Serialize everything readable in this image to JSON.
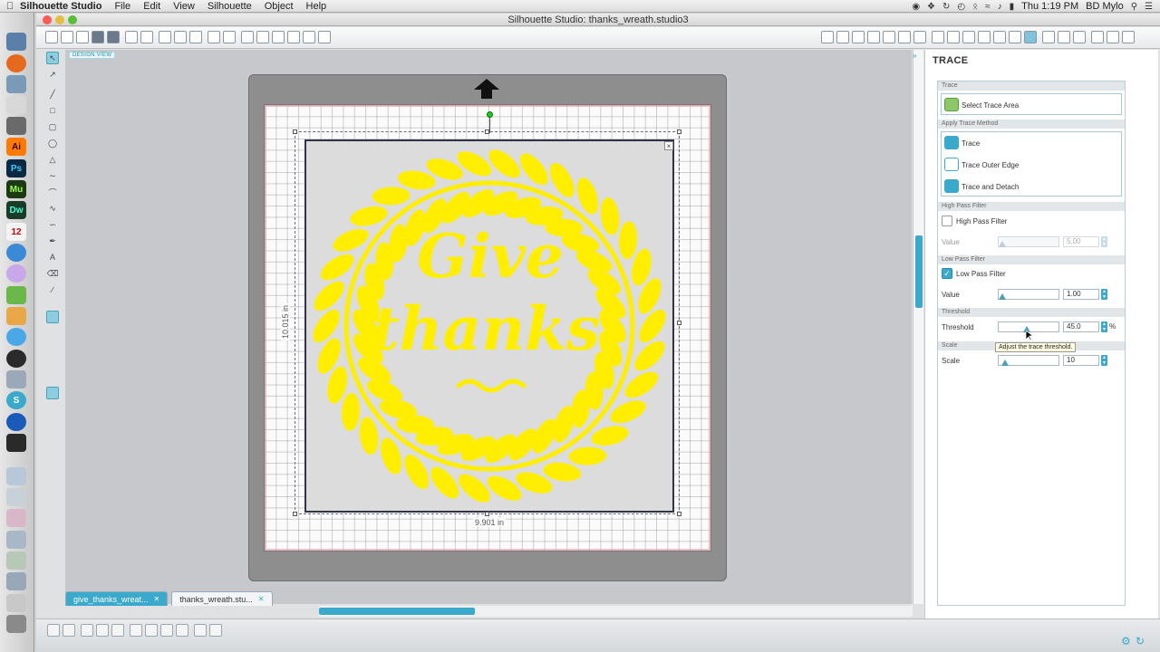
{
  "menubar": {
    "app_name": "Silhouette Studio",
    "menus": [
      "File",
      "Edit",
      "View",
      "Silhouette",
      "Object",
      "Help"
    ],
    "clock": "Thu 1:19 PM",
    "user": "BD Mylo"
  },
  "window": {
    "title": "Silhouette Studio: thanks_wreath.studio3"
  },
  "canvas": {
    "design_view_label": "DESIGN VIEW",
    "width_label": "9.901 in",
    "height_label": "10.015 in",
    "artwork_text_line1": "Give",
    "artwork_text_line2": "thanks",
    "artwork_color": "#ffee00"
  },
  "doc_tabs": [
    {
      "label": "give_thanks_wreat..."
    },
    {
      "label": "thanks_wreath.stu..."
    }
  ],
  "panel": {
    "title": "TRACE",
    "sections": {
      "trace": "Trace",
      "method": "Apply Trace Method",
      "high_pass": "High Pass Filter",
      "low_pass": "Low Pass Filter",
      "threshold": "Threshold",
      "scale": "Scale"
    },
    "select_trace_area": "Select Trace Area",
    "methods": [
      "Trace",
      "Trace Outer Edge",
      "Trace and Detach"
    ],
    "high_pass": {
      "label": "High Pass Filter",
      "checked": false,
      "value_label": "Value",
      "value": "5.00"
    },
    "low_pass": {
      "label": "Low Pass Filter",
      "checked": true,
      "value_label": "Value",
      "value": "1.00"
    },
    "threshold": {
      "label": "Threshold",
      "value": "45.0",
      "unit": "%",
      "level": 0.45
    },
    "scale": {
      "label": "Scale",
      "value": "10"
    },
    "tooltip": "Adjust the trace threshold."
  },
  "colors": {
    "accent": "#3aa9cc",
    "artwork": "#ffee00"
  }
}
